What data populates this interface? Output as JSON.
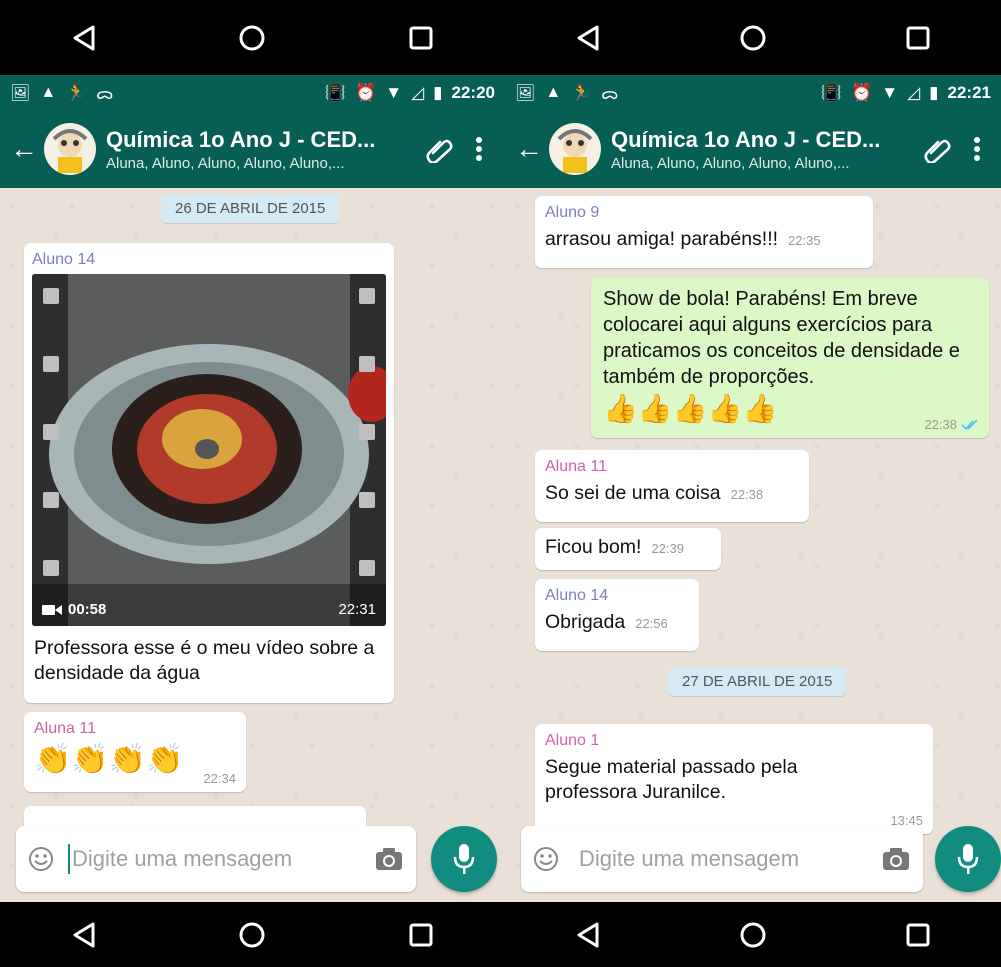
{
  "left": {
    "status_time": "22:20",
    "chat_title": "Química 1o Ano J - CED...",
    "chat_subtitle": "Aluna, Aluno, Aluno, Aluno, Aluno,...",
    "date_separator": "26 DE ABRIL DE 2015",
    "video_message": {
      "sender": "Aluno 14",
      "duration": "00:58",
      "time": "22:31",
      "caption": "Professora esse é o meu vídeo sobre a densidade da água"
    },
    "clap_message": {
      "sender": "Aluna 11",
      "emoji": "👏👏👏👏",
      "time": "22:34"
    },
    "composer_placeholder": "Digite uma mensagem"
  },
  "right": {
    "status_time": "22:21",
    "chat_title": "Química 1o Ano J - CED...",
    "chat_subtitle": "Aluna, Aluno, Aluno, Aluno, Aluno,...",
    "messages": [
      {
        "sender": "Aluno 9",
        "text": "arrasou amiga! parabéns!!!",
        "time": "22:35"
      },
      {
        "text": "Show de bola! Parabéns! Em breve colocarei aqui alguns exercícios para praticamos os conceitos de densidade e também de proporções.",
        "emoji": "👍👍👍👍👍",
        "time": "22:38"
      },
      {
        "sender": "Aluna 11",
        "text": "So sei de uma coisa",
        "time": "22:38"
      },
      {
        "text": "Ficou bom!",
        "time": "22:39"
      },
      {
        "sender": "Aluno 14",
        "text": "Obrigada",
        "time": "22:56"
      },
      {
        "sender": "Aluno 1",
        "text": "Segue material passado pela professora Juranilce.",
        "time": "13:45"
      }
    ],
    "date_separator": "27 DE ABRIL DE 2015",
    "composer_placeholder": "Digite uma mensagem"
  },
  "colors": {
    "header": "#075e54",
    "chat_bg": "#e9e1d8",
    "outgoing_bubble": "#dcf8c6",
    "mic_button": "#128c7e",
    "sender_aluno": "#7c7dc9",
    "sender_aluna": "#d660a8",
    "read_ticks": "#4fc3f7"
  },
  "icons": [
    "back-icon",
    "home-icon",
    "recents-icon",
    "back-arrow-icon",
    "attach-icon",
    "more-icon",
    "emoji-icon",
    "camera-icon",
    "mic-icon",
    "video-camera-icon",
    "double-check-icon"
  ]
}
